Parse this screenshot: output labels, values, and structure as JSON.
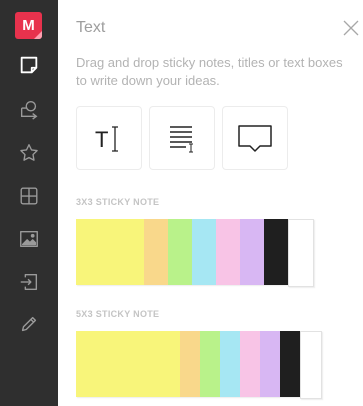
{
  "sidebar": {
    "logo_letter": "M",
    "items": [
      {
        "name": "sticky-note-icon",
        "active": true
      },
      {
        "name": "shapes-icon"
      },
      {
        "name": "star-icon"
      },
      {
        "name": "grid-icon"
      },
      {
        "name": "image-icon"
      },
      {
        "name": "import-icon"
      },
      {
        "name": "pencil-icon"
      }
    ]
  },
  "panel": {
    "title": "Text",
    "description": "Drag and drop sticky notes, titles or text boxes to write down your ideas.",
    "tools": [
      {
        "name": "text-tool",
        "icon": "text-cursor-icon",
        "glyph": "T"
      },
      {
        "name": "paragraph-tool",
        "icon": "paragraph-lines-icon"
      },
      {
        "name": "comment-tool",
        "icon": "speech-bubble-icon"
      }
    ]
  },
  "sticky_3x3": {
    "label": "3X3 STICKY NOTE",
    "colors": [
      "#f8f57a",
      "#f9d88b",
      "#b9f28a",
      "#a6e7f3",
      "#f8c4e6",
      "#d8b7f3",
      "#1f1f1f",
      "#ffffff"
    ]
  },
  "sticky_5x5": {
    "label": "5X3 STICKY NOTE",
    "colors": [
      "#f8f57a",
      "#f9d88b",
      "#b9f28a",
      "#a6e7f3",
      "#f8c4e6",
      "#d8b7f3",
      "#1f1f1f",
      "#ffffff"
    ]
  },
  "colors": {
    "sidebar_bg": "#2f2f2f",
    "logo_bg": "#e8324d",
    "icon_color": "#9a9a9a",
    "active_icon_color": "#ffffff"
  }
}
